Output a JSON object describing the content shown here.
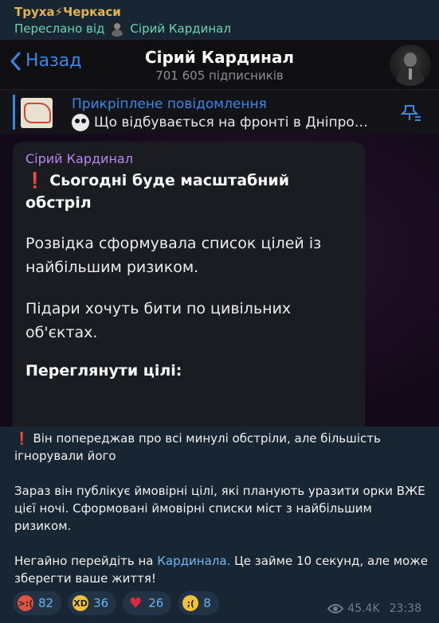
{
  "post": {
    "channel": "Труха⚡Черкаси",
    "forwarded_prefix": "Переслано від",
    "forwarded_from": "Сірий Кардинал"
  },
  "screenshot": {
    "back_label": "Назад",
    "chat_title": "Сірий Кардинал",
    "subscribers": "701 605 підписників",
    "pinned_title": "Прикріплене повідомлення",
    "pinned_text": "Що відбувається на фронті в Дніпро…",
    "bubble_author": "Сірий Кардинал",
    "bubble_exclaim": "❗",
    "bubble_headline": "Сьогодні буде масштабний обстріл",
    "bubble_p1": "Розвідка сформувала список цілей із найбільшим ризиком.",
    "bubble_p2": "Підари хочуть бити по цивільних об'єктах.",
    "bubble_bold": "Переглянути цілі:"
  },
  "message": {
    "exclaim": "❗",
    "p1": "Він попереджав про всі минулі обстріли, але більшість ігнорували його",
    "p2": "Зараз він публікує ймовірні цілі, які планують уразити орки ВЖЕ цієї ночі. Сформовані ймовірні списки міст з найбільшим ризиком.",
    "p3_before": "Негайно перейдіть на",
    "p3_link": "Кардинала.",
    "p3_after": "Це займе 10 секунд, але може зберегти ваше життя!"
  },
  "reactions": [
    {
      "icon": "angry-face-icon",
      "count": "82"
    },
    {
      "icon": "laughing-face-icon",
      "count": "36"
    },
    {
      "icon": "heart-icon",
      "count": "26"
    },
    {
      "icon": "crying-face-icon",
      "count": "8"
    }
  ],
  "meta": {
    "views": "45.4K",
    "time": "23:38"
  },
  "colors": {
    "background": "#182533",
    "channel_name": "#e3b64b",
    "forwarded": "#67d6b1",
    "link": "#71baf7",
    "reaction_count": "#6ab3f3",
    "accent_blue": "#3a88e6",
    "author_purple": "#b888f0"
  }
}
